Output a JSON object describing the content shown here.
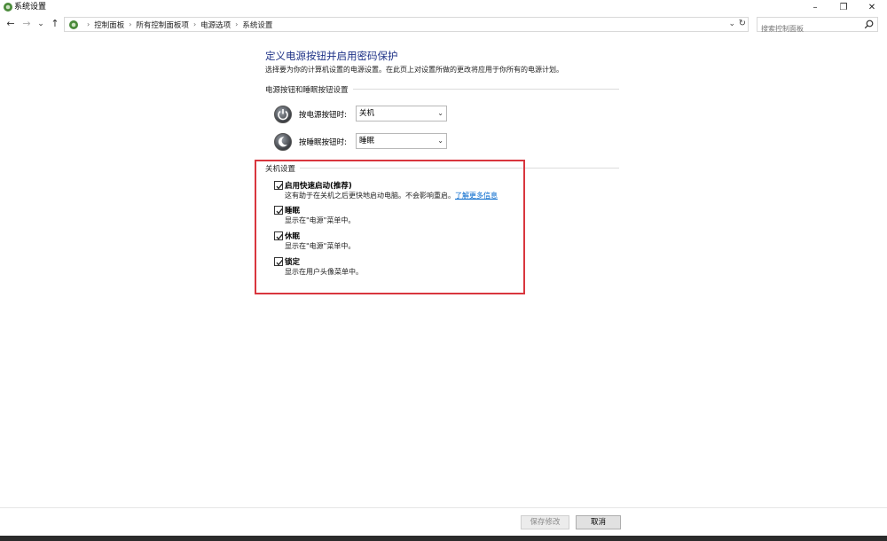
{
  "window": {
    "title": "系统设置",
    "minimize": "–",
    "restore": "❐",
    "close": "✕"
  },
  "nav": {
    "back": "←",
    "forward": "→",
    "recent": "⌄",
    "up": "↑",
    "breadcrumbs": [
      "控制面板",
      "所有控制面板项",
      "电源选项",
      "系统设置"
    ],
    "separator": "›",
    "search_placeholder": "搜索控制面板"
  },
  "page": {
    "title": "定义电源按钮并启用密码保护",
    "description": "选择要为你的计算机设置的电源设置。在此页上对设置所做的更改将应用于你所有的电源计划。"
  },
  "power_section": {
    "heading": "电源按钮和睡眠按钮设置",
    "rows": [
      {
        "label": "按电源按钮时:",
        "value": "关机"
      },
      {
        "label": "按睡眠按钮时:",
        "value": "睡眠"
      }
    ]
  },
  "shutdown_section": {
    "heading": "关机设置",
    "items": [
      {
        "title": "启用快速启动(推荐)",
        "desc": "这有助于在关机之后更快地启动电脑。不会影响重启。",
        "link": "了解更多信息",
        "checked": true
      },
      {
        "title": "睡眠",
        "desc": "显示在\"电源\"菜单中。",
        "checked": true
      },
      {
        "title": "休眠",
        "desc": "显示在\"电源\"菜单中。",
        "checked": true
      },
      {
        "title": "锁定",
        "desc": "显示在用户头像菜单中。",
        "checked": true
      }
    ]
  },
  "footer": {
    "save": "保存修改",
    "cancel": "取消"
  },
  "colors": {
    "title_blue": "#1e3287",
    "link_blue": "#0066cc",
    "highlight_red": "#d9363e"
  }
}
